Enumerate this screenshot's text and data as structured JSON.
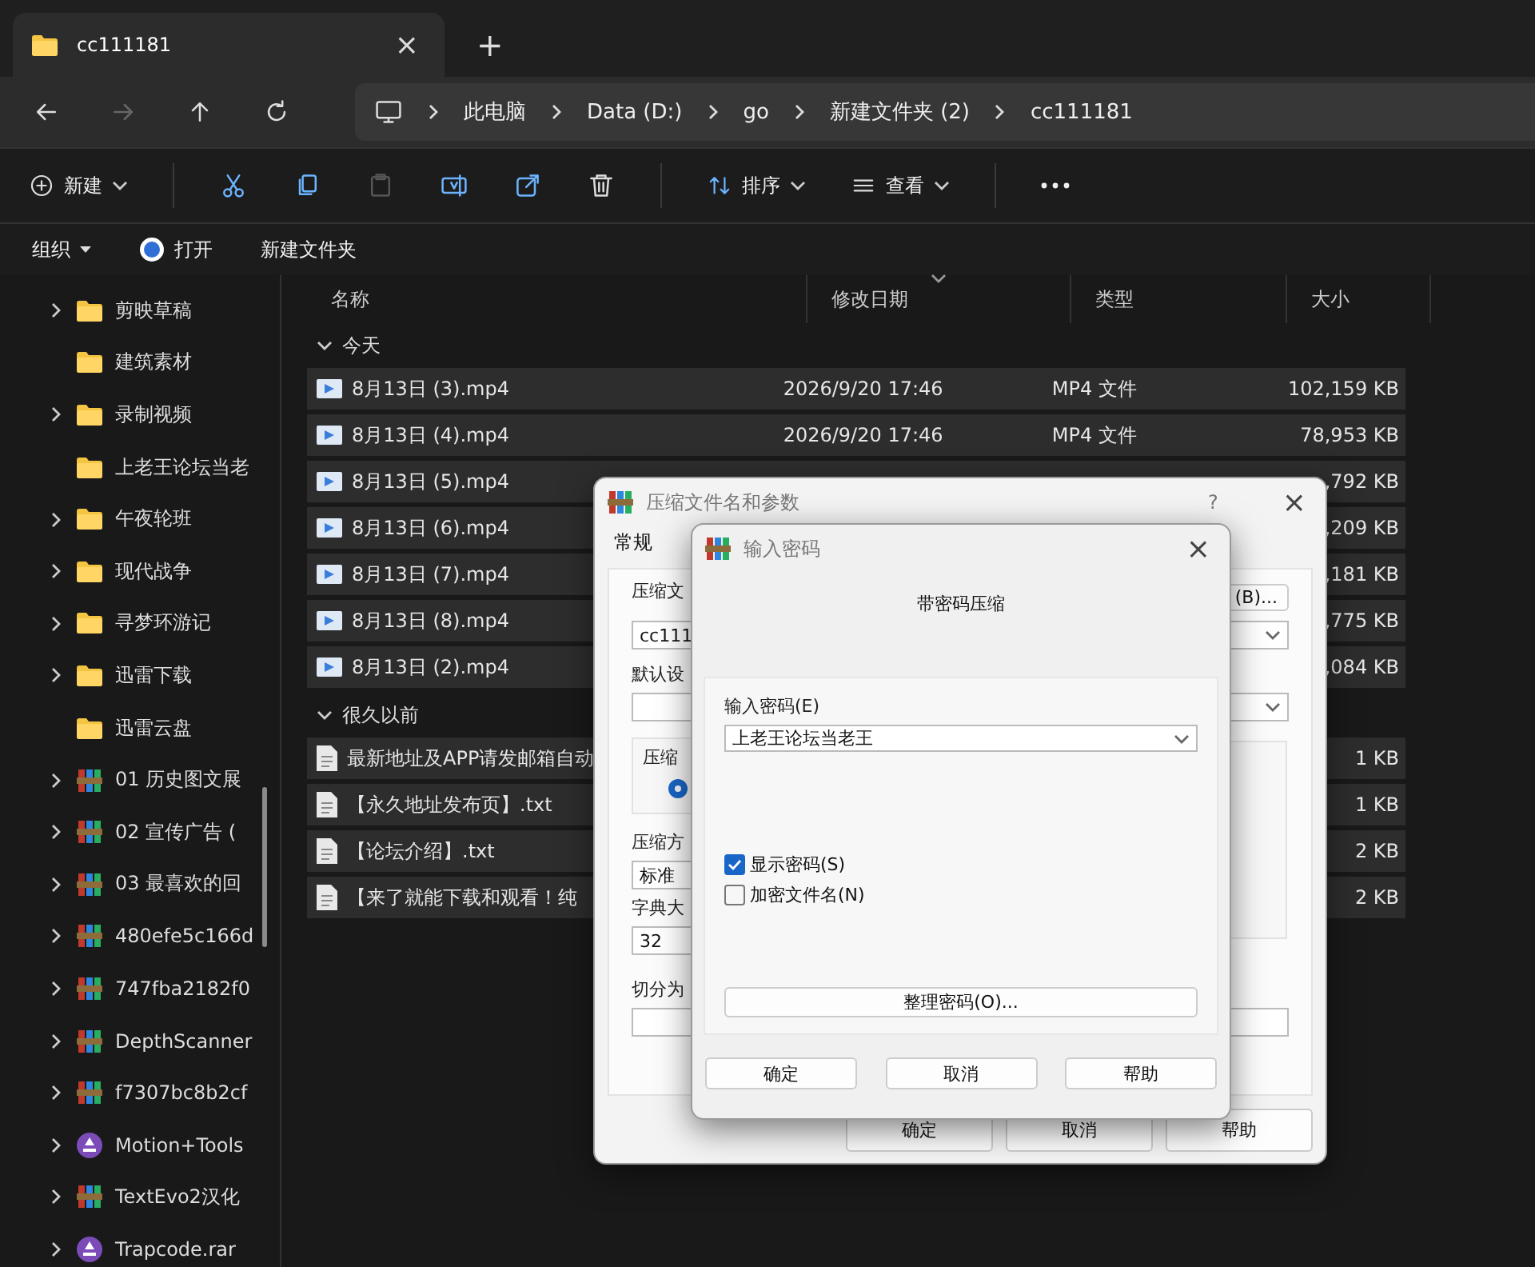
{
  "tab": {
    "title": "cc111181",
    "close": "×"
  },
  "new_tab": "+",
  "nav": {
    "forward_disabled": true
  },
  "breadcrumb": [
    "此电脑",
    "Data (D:)",
    "go",
    "新建文件夹 (2)",
    "cc111181"
  ],
  "toolbar": {
    "new": "新建",
    "paste_disabled": true,
    "sort": "排序",
    "view": "查看"
  },
  "commands": {
    "organize": "组织",
    "open": "打开",
    "new_folder": "新建文件夹"
  },
  "sidebar": {
    "items": [
      {
        "label": "剪映草稿",
        "kind": "folder",
        "expandable": true
      },
      {
        "label": "建筑素材",
        "kind": "folder",
        "expandable": false
      },
      {
        "label": "录制视频",
        "kind": "folder",
        "expandable": true
      },
      {
        "label": "上老王论坛当老",
        "kind": "folder",
        "expandable": false
      },
      {
        "label": "午夜轮班",
        "kind": "folder",
        "expandable": true
      },
      {
        "label": "现代战争",
        "kind": "folder",
        "expandable": true
      },
      {
        "label": "寻梦环游记",
        "kind": "folder",
        "expandable": true
      },
      {
        "label": "迅雷下载",
        "kind": "folder",
        "expandable": true
      },
      {
        "label": "迅雷云盘",
        "kind": "folder",
        "expandable": false
      },
      {
        "label": "01 历史图文展",
        "kind": "archive",
        "expandable": true
      },
      {
        "label": "02 宣传广告 (",
        "kind": "archive",
        "expandable": true
      },
      {
        "label": "03 最喜欢的回",
        "kind": "archive",
        "expandable": true
      },
      {
        "label": "480efe5c166d",
        "kind": "archive",
        "expandable": true
      },
      {
        "label": "747fba2182f0",
        "kind": "archive",
        "expandable": true
      },
      {
        "label": "DepthScanner",
        "kind": "archive",
        "expandable": true
      },
      {
        "label": "f7307bc8b2cf",
        "kind": "archive",
        "expandable": true
      },
      {
        "label": "Motion+Tools",
        "kind": "app",
        "expandable": true
      },
      {
        "label": "TextEvo2汉化",
        "kind": "archive",
        "expandable": true
      },
      {
        "label": "Trapcode.rar",
        "kind": "app",
        "expandable": true
      }
    ]
  },
  "columns": [
    "名称",
    "修改日期",
    "类型",
    "大小"
  ],
  "groups": [
    {
      "label": "今天",
      "expanded": true,
      "rows": [
        {
          "kind": "video",
          "name": "8月13日 (3).mp4",
          "date": "2026/9/20 17:46",
          "type": "MP4 文件",
          "size": "102,159 KB"
        },
        {
          "kind": "video",
          "name": "8月13日 (4).mp4",
          "date": "2026/9/20 17:46",
          "type": "MP4 文件",
          "size": "78,953 KB"
        },
        {
          "kind": "video",
          "name": "8月13日 (5).mp4",
          "size": ",792 KB"
        },
        {
          "kind": "video",
          "name": "8月13日 (6).mp4",
          "size": ",209 KB"
        },
        {
          "kind": "video",
          "name": "8月13日 (7).mp4",
          "size": ",181 KB"
        },
        {
          "kind": "video",
          "name": "8月13日 (8).mp4",
          "size": ",775 KB"
        },
        {
          "kind": "video",
          "name": "8月13日 (2).mp4",
          "size": ",084 KB"
        }
      ]
    },
    {
      "label": "很久以前",
      "expanded": true,
      "rows": [
        {
          "kind": "text",
          "name": "最新地址及APP请发邮箱自动",
          "size": "1 KB"
        },
        {
          "kind": "text",
          "name": "【永久地址发布页】.txt",
          "size": "1 KB"
        },
        {
          "kind": "text",
          "name": "【论坛介绍】.txt",
          "size": "2 KB"
        },
        {
          "kind": "text",
          "name": "【来了就能下载和观看！纯",
          "size": "2 KB"
        }
      ]
    }
  ],
  "archive_dialog": {
    "title": "压缩文件名和参数",
    "help": "?",
    "close": "×",
    "tab": "常规",
    "name_label": "压缩文",
    "browse": "(B)...",
    "name_value": "cc111",
    "profile_label": "默认设",
    "format_label": "压缩",
    "format_selected": true,
    "method_label": "压缩方",
    "method_value": "标准",
    "dict_label": "字典大",
    "dict_value": "32",
    "split_label": "切分为",
    "buttons": [
      "确定",
      "取消",
      "帮助"
    ]
  },
  "password_dialog": {
    "title": "输入密码",
    "close": "×",
    "heading": "带密码压缩",
    "field_label": "输入密码(E)",
    "password": "上老王论坛当老王",
    "options": [
      {
        "label": "显示密码(S)",
        "checked": true
      },
      {
        "label": "加密文件名(N)",
        "checked": false
      }
    ],
    "organize": "整理密码(O)...",
    "buttons": [
      "确定",
      "取消",
      "帮助"
    ]
  }
}
